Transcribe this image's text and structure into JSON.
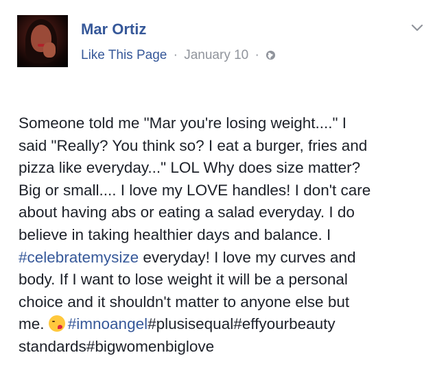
{
  "post": {
    "author": "Mar Ortiz",
    "like_link": "Like This Page",
    "separator": "·",
    "date": "January 10",
    "icons": {
      "audience": "globe-icon",
      "menu": "chevron-down-icon",
      "emoji": "kissing-face-emoji-icon"
    },
    "lines": {
      "l1": "Someone told me \"Mar you're losing weight....\" I",
      "l2": "said \"Really? You think so? I eat a burger, fries and",
      "l3": "pizza like everyday...\" LOL Why does size matter?",
      "l4": "Big or small.... I love my LOVE handles! I don't care",
      "l5": "about having abs or eating a salad everyday. I do",
      "l6": "believe in taking healthier days and balance. I",
      "l7_tag": "#celebratemysize",
      "l7_rest": " everyday! I love my curves and",
      "l8": "body. If I want to lose weight it will be a personal",
      "l9": "choice and it shouldn't matter to anyone else but",
      "l10_pre": "me. ",
      "l10_tag1": "#imnoangel",
      "l10_rest": "#plusisequal#effyourbeauty",
      "l11": "standards#bigwomenbiglove"
    }
  },
  "colors": {
    "link": "#365899",
    "meta": "#90949c",
    "text": "#1d2129"
  }
}
